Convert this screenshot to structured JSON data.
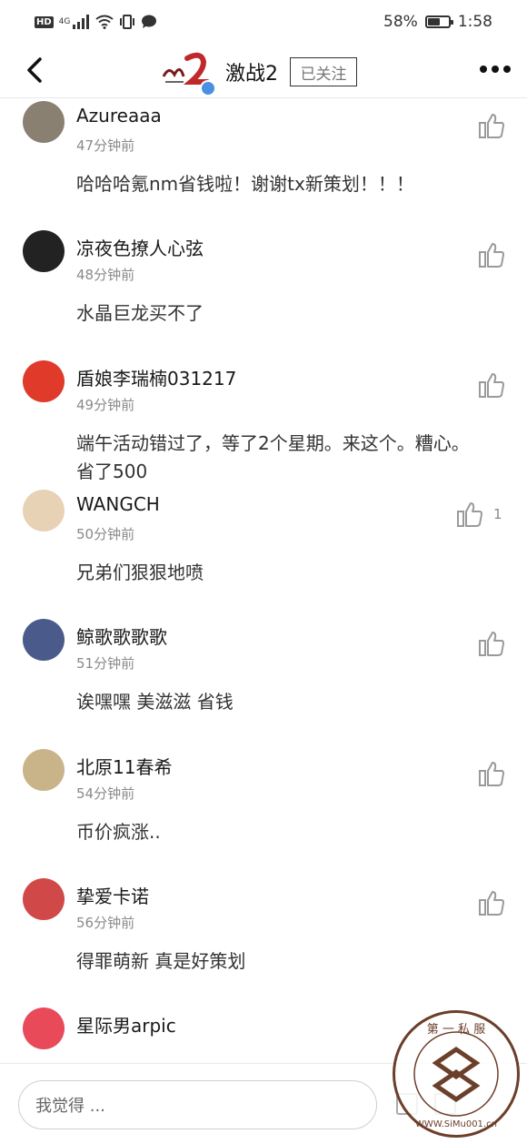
{
  "status_bar": {
    "hd": "HD",
    "network": "4G",
    "battery_percent": "58%",
    "battery_level": 0.58,
    "time": "1:58"
  },
  "header": {
    "back_icon": "chevron-left-icon",
    "title": "激战2",
    "follow_label": "已关注",
    "more_icon": "more-horizontal-icon"
  },
  "comments": [
    {
      "username": "Azureaaa",
      "time": "47分钟前",
      "text": "哈哈哈氪nm省钱啦！谢谢tx新策划！！！",
      "likes": ""
    },
    {
      "username": "凉夜色撩人心弦",
      "time": "48分钟前",
      "text": "水晶巨龙买不了",
      "likes": ""
    },
    {
      "username": "盾娘李瑞楠031217",
      "time": "49分钟前",
      "text": "端午活动错过了，等了2个星期。来这个。糟心。省了500",
      "likes": ""
    },
    {
      "username": "WANGCH",
      "time": "50分钟前",
      "text": "兄弟们狠狠地喷",
      "likes": "1"
    },
    {
      "username": "鲸歌歌歌歌",
      "time": "51分钟前",
      "text": "诶嘿嘿 美滋滋 省钱",
      "likes": ""
    },
    {
      "username": "北原11春希",
      "time": "54分钟前",
      "text": "币价疯涨..",
      "likes": ""
    },
    {
      "username": "挚爱卡诺",
      "time": "56分钟前",
      "text": "得罪萌新  真是好策划",
      "likes": ""
    },
    {
      "username": "星际男arpic",
      "time": "",
      "text": "",
      "likes": ""
    }
  ],
  "input": {
    "placeholder": "我觉得 ..."
  },
  "watermark": {
    "text": "第一私服 WWW.SiMu001.cn"
  },
  "colors": {
    "like_icon": "#9a9a9a",
    "divider": "#e8e8e8",
    "verified": "#4a90e2",
    "watermark": "#6b3f2a"
  }
}
